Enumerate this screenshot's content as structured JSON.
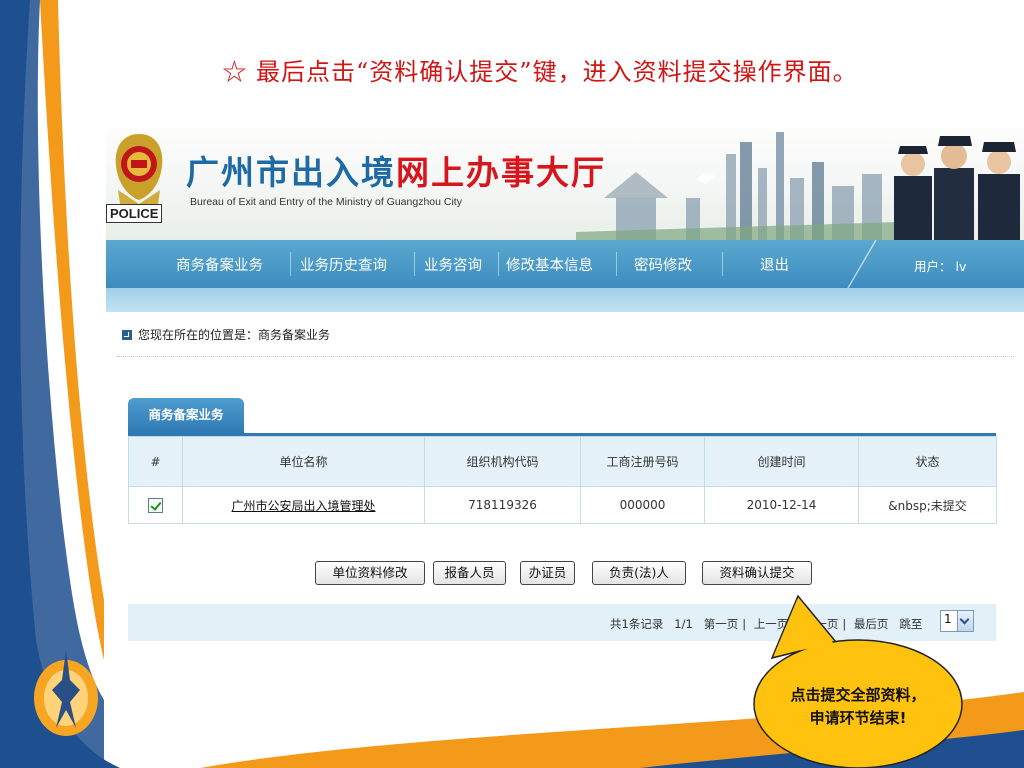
{
  "slide": {
    "instruction": "☆ 最后点击“资料确认提交”键，进入资料提交操作界面。",
    "callout_line1": "点击提交全部资料，",
    "callout_line2": "申请环节结束!",
    "colors": {
      "orange": "#f39a1b",
      "blue": "#1f4f8e",
      "callout_fill": "#ffc20e",
      "instruction_red": "#d21414"
    }
  },
  "header": {
    "police_tag": "POLICE",
    "title_blue": "广州市出入境",
    "title_red": "网上办事大厅",
    "subtitle": "Bureau of Exit and Entry of the Ministry of Guangzhou City"
  },
  "nav": {
    "items": [
      {
        "label": "商务备案业务"
      },
      {
        "label": "业务历史查询"
      },
      {
        "label": "业务咨询"
      },
      {
        "label": "修改基本信息"
      },
      {
        "label": "密码修改"
      },
      {
        "label": "退出"
      }
    ],
    "user_label": "用户：",
    "user_value": "lv",
    "colors": {
      "bar": "#4a98c7",
      "subbar": "#b4dbef"
    }
  },
  "breadcrumb": "您现在所在的位置是：商务备案业务",
  "tab": {
    "label": "商务备案业务"
  },
  "table": {
    "headers": [
      "#",
      "单位名称",
      "组织机构代码",
      "工商注册号码",
      "创建时间",
      "状态"
    ],
    "rows": [
      {
        "checked": true,
        "unit_name": "广州市公安局出入境管理处",
        "org_code": "718119326",
        "reg_no": "000000",
        "created": "2010-12-14",
        "status": "&nbsp;未提交"
      }
    ]
  },
  "buttons": {
    "edit_unit": "单位资料修改",
    "reporter": "报备人员",
    "certifier": "办证员",
    "legal_person": "负责(法)人",
    "confirm_submit": "资料确认提交"
  },
  "pager": {
    "records": "共1条记录",
    "page": "1/1",
    "first": "第一页",
    "prev": "上一页",
    "next": "下一页",
    "last": "最后页",
    "jump": "跳至",
    "selected": "1"
  }
}
